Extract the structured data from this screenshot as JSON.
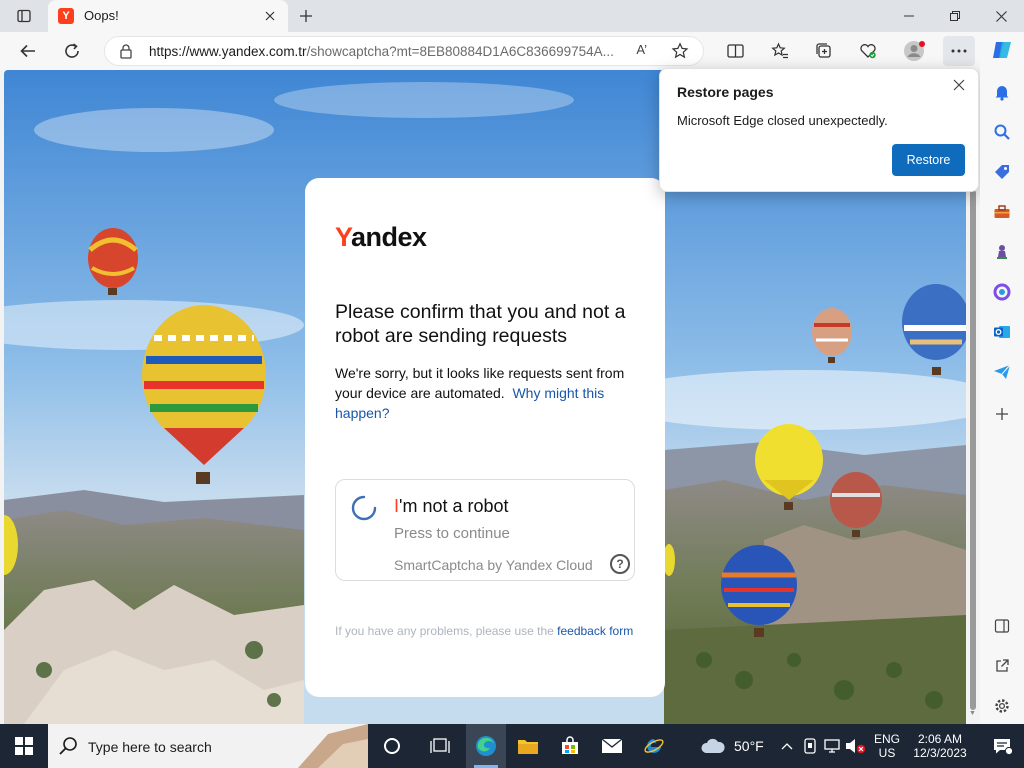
{
  "browser": {
    "tab": {
      "favicon_letter": "Y",
      "title": "Oops!"
    },
    "address": {
      "url_host": "https://www.yandex.com.tr",
      "url_path": "/showcaptcha?mt=8EB80884D1A6C836699754A...",
      "read_aloud": "A’"
    }
  },
  "page": {
    "logo": {
      "first": "Y",
      "rest": "andex"
    },
    "heading": "Please confirm that you and not a robot are sending requests",
    "paragraph": "We're sorry, but it looks like requests sent from your device are automated.",
    "why_link": "Why might this happen?",
    "captcha": {
      "title_first": "I",
      "title_rest": "'m not a robot",
      "subtitle": "Press to continue",
      "brand": "SmartCaptcha by Yandex Cloud",
      "help": "?"
    },
    "footer_text": "If you have any problems, please use the",
    "feedback_link": "feedback form"
  },
  "popup": {
    "title": "Restore pages",
    "message": "Microsoft Edge closed unexpectedly.",
    "button": "Restore"
  },
  "taskbar": {
    "search_placeholder": "Type here to search",
    "weather": "50°F",
    "lang_top": "ENG",
    "lang_bottom": "US",
    "time": "2:06 AM",
    "date": "12/3/2023"
  },
  "colors": {
    "yandex_red": "#fc3f1d",
    "link_blue": "#1a56a8",
    "restore_button": "#0f6cbd",
    "taskbar": "#1c2634"
  }
}
